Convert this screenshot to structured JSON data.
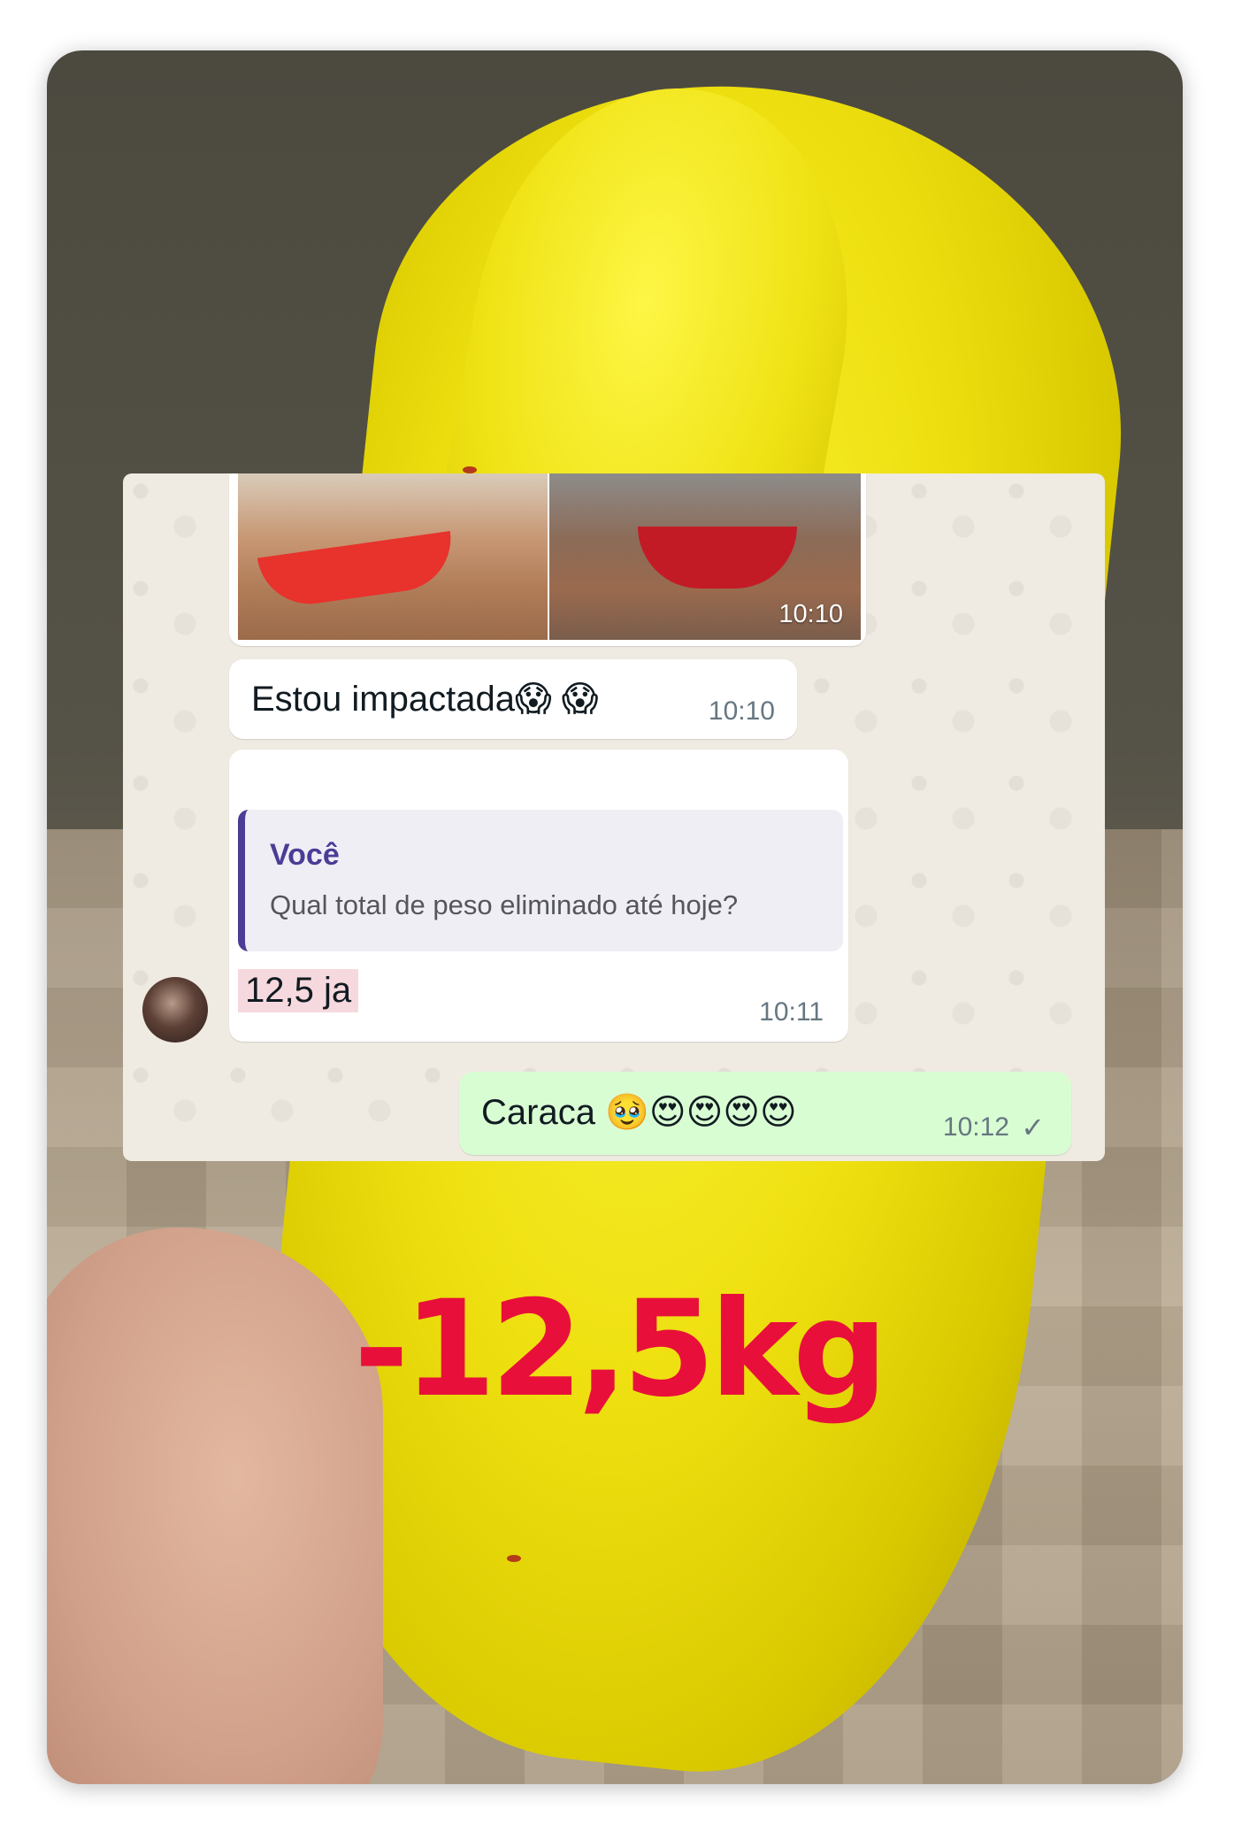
{
  "chat": {
    "photo_time": "10:10",
    "message1": {
      "text": "Estou impactada😱 😱",
      "time": "10:10"
    },
    "reply": {
      "quote_author": "Você",
      "quote_text": "Qual total de peso eliminado até hoje?",
      "text": "12,5 ja",
      "time": "10:11"
    },
    "outgoing": {
      "text": "Caraca 🥹😍😍😍😍",
      "time": "10:12",
      "status_icon": "✓"
    }
  },
  "overlay": {
    "weight_text": "-12,5kg",
    "color": "#e8103a"
  }
}
